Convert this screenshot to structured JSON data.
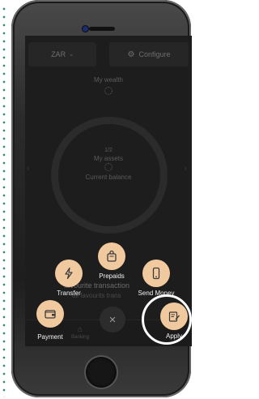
{
  "currency_selector": {
    "value": "ZAR",
    "caret": "⌄"
  },
  "configure_button": {
    "label": "Configure",
    "icon": "gear-icon"
  },
  "wealth": {
    "label": "My wealth"
  },
  "carousel": {
    "page_indicator": "1/2",
    "assets_label": "My assets",
    "balance_label": "Current balance"
  },
  "favourites": {
    "title": "favourite transaction",
    "subtitle": "all favourits trans"
  },
  "tabbar": {
    "banking_label": "Banking"
  },
  "quick_actions": [
    {
      "key": "prepaids",
      "label": "Prepaids",
      "icon": "bag-icon"
    },
    {
      "key": "transfer",
      "label": "Transfer",
      "icon": "lightning-icon"
    },
    {
      "key": "send_money",
      "label": "Send Money",
      "icon": "phone-icon"
    },
    {
      "key": "payment",
      "label": "Payment",
      "icon": "wallet-icon"
    },
    {
      "key": "apply",
      "label": "Apply",
      "icon": "document-pen-icon"
    }
  ],
  "close_button": {
    "glyph": "×"
  },
  "colors": {
    "action_bg": "#f1c99f",
    "screen_bg": "#1d1d1d",
    "highlight": "#ffffff",
    "side_dots": "#2f8f6b"
  }
}
